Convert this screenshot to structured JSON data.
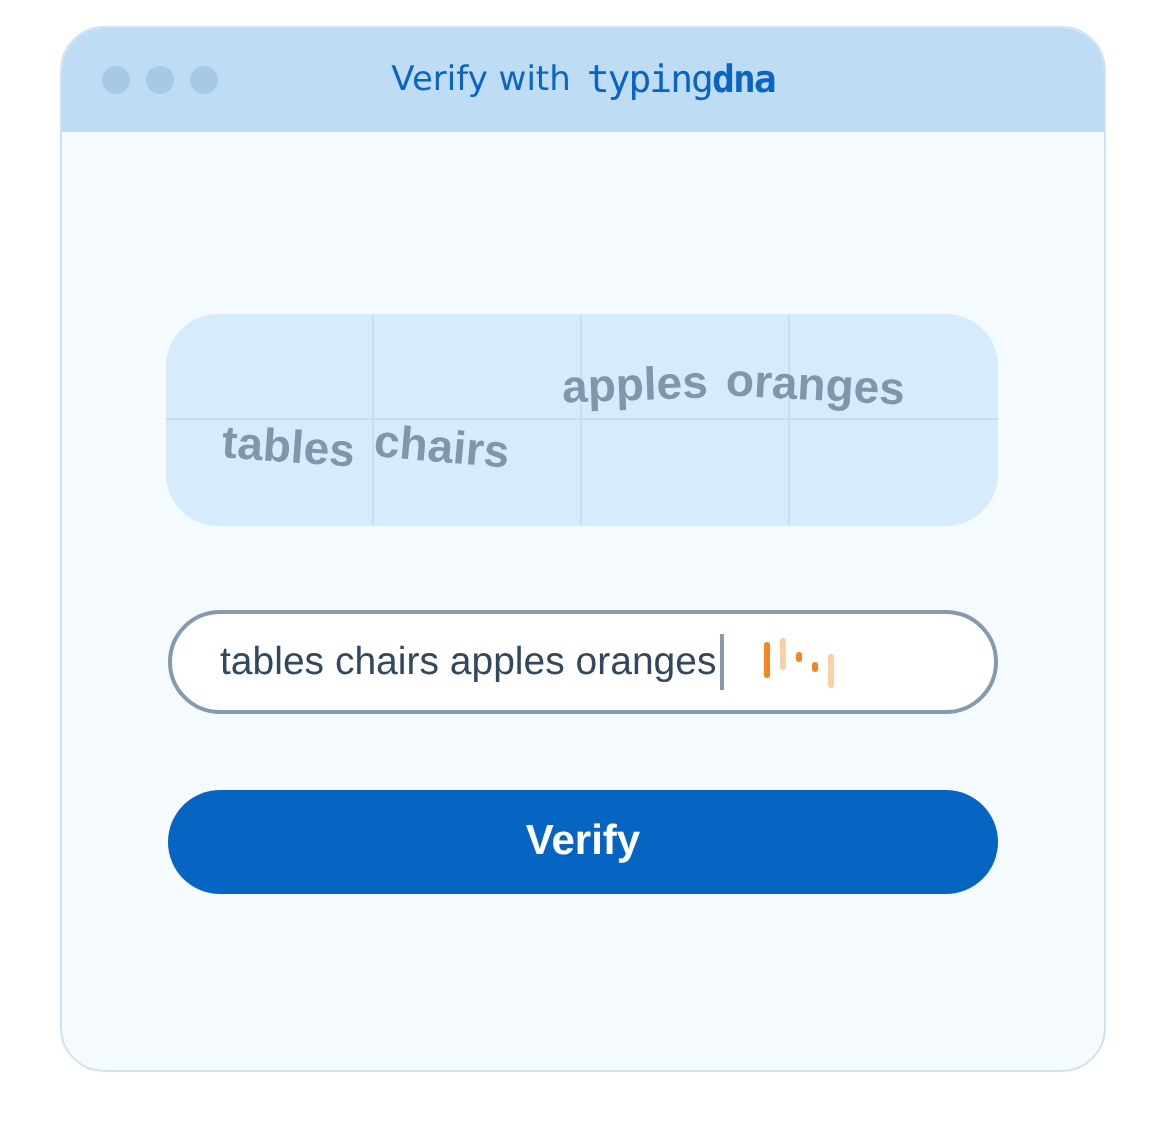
{
  "window": {
    "title": "Verify with",
    "logo": "typing**dna**"
  },
  "captcha": {
    "words": [
      {
        "text": "tables"
      },
      {
        "text": "chairs"
      },
      {
        "text": "apples"
      },
      {
        "text": "oranges"
      }
    ]
  },
  "input": {
    "value": "tables chairs apples oranges"
  },
  "buttons": [
    "Verify"
  ]
}
